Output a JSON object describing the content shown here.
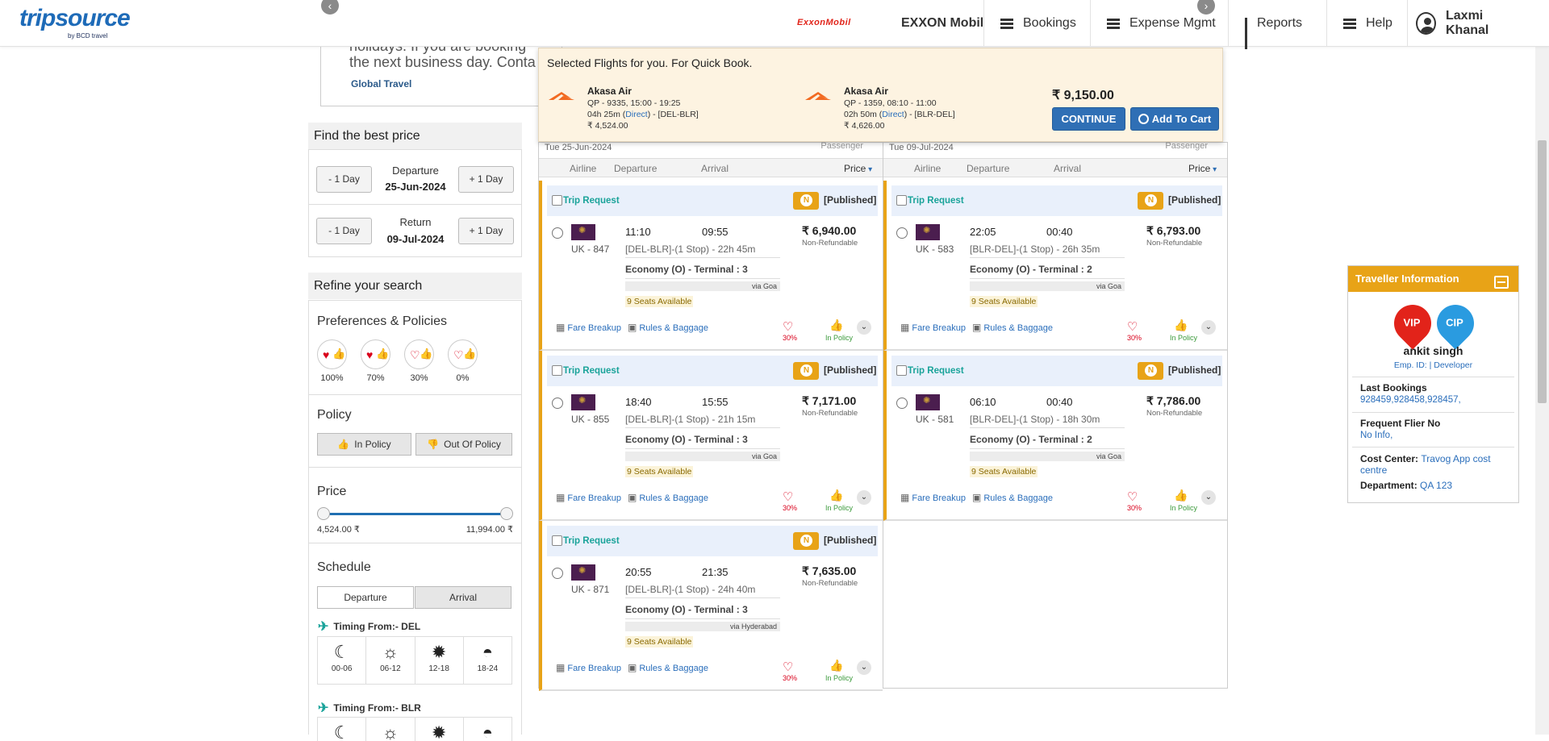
{
  "header": {
    "logo_main": "tripsource",
    "logo_sub": "by BCD travel",
    "company_logo_text": "ExxonMobil",
    "company_name": "EXXON Mobil",
    "nav": [
      "Bookings",
      "Expense Mgmt",
      "Reports",
      "Help"
    ],
    "user_name": "Laxmi Khanal"
  },
  "banner": {
    "line1": "holidays. If you are booking",
    "line2": "the next business day. Conta",
    "brand": "Global Travel"
  },
  "sidebar": {
    "find_best_price": "Find the best price",
    "minus_day": "- 1 Day",
    "plus_day": "+ 1 Day",
    "departure_label": "Departure",
    "departure_date": "25-Jun-2024",
    "return_label": "Return",
    "return_date": "09-Jul-2024",
    "refine_title": "Refine your search",
    "prefs_title": "Preferences & Policies",
    "pref_levels": [
      "100%",
      "70%",
      "30%",
      "0%"
    ],
    "policy_title": "Policy",
    "in_policy": "In Policy",
    "out_of_policy": "Out Of Policy",
    "price_title": "Price",
    "price_min": "4,524.00 ₹",
    "price_max": "11,994.00 ₹",
    "schedule_title": "Schedule",
    "tab_departure": "Departure",
    "tab_arrival": "Arrival",
    "timing_del": "Timing From:- DEL",
    "timing_blr": "Timing From:- BLR",
    "time_slots": [
      "00-06",
      "06-12",
      "12-18",
      "18-24"
    ]
  },
  "quickbook": {
    "title": "Selected Flights for you. For Quick Book.",
    "flights": [
      {
        "airline": "Akasa Air",
        "line1": "QP - 9335, 15:00 - 19:25",
        "duration": "04h 25m (",
        "direct": "Direct",
        "route": ") - [DEL-BLR]",
        "price": "₹ 4,524.00"
      },
      {
        "airline": "Akasa Air",
        "line1": "QP - 1359, 08:10 - 11:00",
        "duration": "02h 50m (",
        "direct": "Direct",
        "route": ") - [BLR-DEL]",
        "price": "₹ 4,626.00"
      }
    ],
    "total": "₹ 9,150.00",
    "continue": "CONTINUE",
    "add_to_cart": "Add To Cart"
  },
  "results": {
    "columns": [
      {
        "date": "Tue 25-Jun-2024",
        "passenger": "Passenger"
      },
      {
        "date": "Tue 09-Jul-2024",
        "passenger": "Passenger"
      }
    ],
    "headers": {
      "airline": "Airline",
      "departure": "Departure",
      "arrival": "Arrival",
      "price": "Price"
    },
    "labels": {
      "trip_request": "Trip Request",
      "published": "[Published]",
      "non_refundable": "Non-Refundable",
      "fare_breakup": "Fare Breakup",
      "rules_baggage": "Rules & Baggage",
      "heart_pct": "30%",
      "in_policy": "In Policy"
    },
    "outbound": [
      {
        "flight": "UK - 847",
        "dep": "11:10",
        "arr": "09:55",
        "route": "[DEL-BLR]-(1 Stop) - 22h 45m",
        "fare": "₹ 6,940.00",
        "class": "Economy (O) - Terminal : 3",
        "via": "via Goa",
        "seats": "9 Seats Available"
      },
      {
        "flight": "UK - 855",
        "dep": "18:40",
        "arr": "15:55",
        "route": "[DEL-BLR]-(1 Stop) - 21h 15m",
        "fare": "₹ 7,171.00",
        "class": "Economy (O) - Terminal : 3",
        "via": "via Goa",
        "seats": "9 Seats Available"
      },
      {
        "flight": "UK - 871",
        "dep": "20:55",
        "arr": "21:35",
        "route": "[DEL-BLR]-(1 Stop) - 24h 40m",
        "fare": "₹ 7,635.00",
        "class": "Economy (O) - Terminal : 3",
        "via": "via Hyderabad",
        "seats": "9 Seats Available"
      }
    ],
    "inbound": [
      {
        "flight": "UK - 583",
        "dep": "22:05",
        "arr": "00:40",
        "route": "[BLR-DEL]-(1 Stop) - 26h 35m",
        "fare": "₹ 6,793.00",
        "class": "Economy (O) - Terminal : 2",
        "via": "via Goa",
        "seats": "9 Seats Available"
      },
      {
        "flight": "UK - 581",
        "dep": "06:10",
        "arr": "00:40",
        "route": "[BLR-DEL]-(1 Stop) - 18h 30m",
        "fare": "₹ 7,786.00",
        "class": "Economy (O) - Terminal : 2",
        "via": "via Goa",
        "seats": "9 Seats Available"
      }
    ]
  },
  "traveller": {
    "title": "Traveller Information",
    "vip": "VIP",
    "cip": "CIP",
    "name": "ankit singh",
    "emp": "Emp. ID: | Developer",
    "last_bookings_label": "Last Bookings",
    "last_bookings": "928459,928458,928457,",
    "ffn_label": "Frequent Flier No",
    "ffn": "No Info,",
    "cost_center_label": "Cost Center",
    "cost_center": "Travog App cost centre",
    "department_label": "Department",
    "department": "QA 123"
  },
  "colors": {
    "accent": "#2f6fb5",
    "gold": "#e8a317",
    "teal": "#1aa39a",
    "red": "#d9001b",
    "green": "#3a9a3a"
  },
  "icons": [
    "chevron-left-icon",
    "chevron-right-icon",
    "menu-icon",
    "bar-chart-icon",
    "user-icon",
    "heart-icon",
    "thumbs-up-icon",
    "thumbs-down-icon",
    "plane-icon",
    "moon-icon",
    "sunrise-icon",
    "sun-icon",
    "sunset-icon",
    "calculator-icon",
    "briefcase-icon",
    "minimize-icon"
  ]
}
